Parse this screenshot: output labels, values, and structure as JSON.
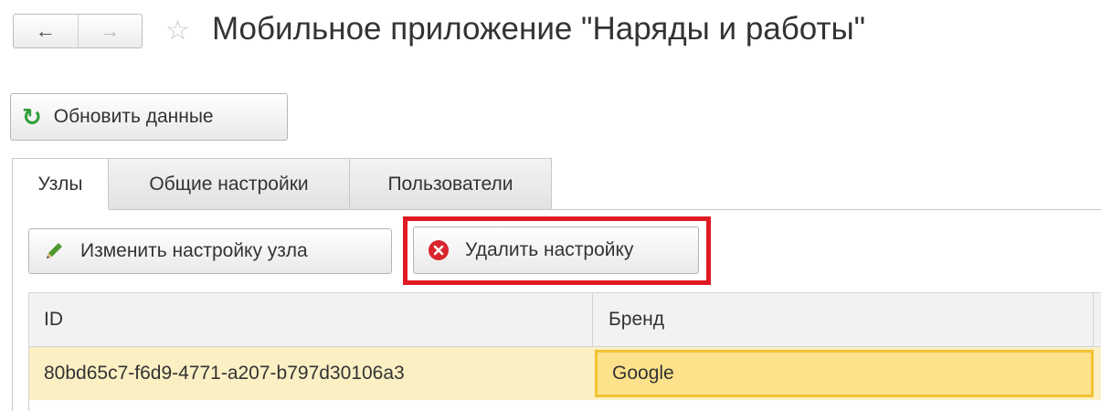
{
  "nav": {
    "back": "←",
    "forward": "→"
  },
  "title": "Мобильное приложение \"Наряды и работы\"",
  "refresh_button": {
    "icon": "refresh-icon",
    "label": "Обновить данные"
  },
  "tabs": [
    {
      "label": "Узлы",
      "active": true
    },
    {
      "label": "Общие настройки",
      "active": false
    },
    {
      "label": "Пользователи",
      "active": false
    }
  ],
  "toolbar": {
    "edit_button": {
      "icon": "pencil-icon",
      "label": "Изменить настройку узла"
    },
    "delete_button": {
      "icon": "delete-circle-icon",
      "label": "Удалить настройку"
    }
  },
  "table": {
    "columns": [
      "ID",
      "Бренд"
    ],
    "rows": [
      [
        "80bd65c7-f6d9-4771-a207-b797d30106a3",
        "Google"
      ]
    ]
  },
  "colors": {
    "highlight_frame": "#e11924",
    "selected_row": "#fbefc4",
    "active_cell": "#fde28b",
    "refresh_icon": "#2e9e3a",
    "delete_icon": "#d9262e"
  }
}
